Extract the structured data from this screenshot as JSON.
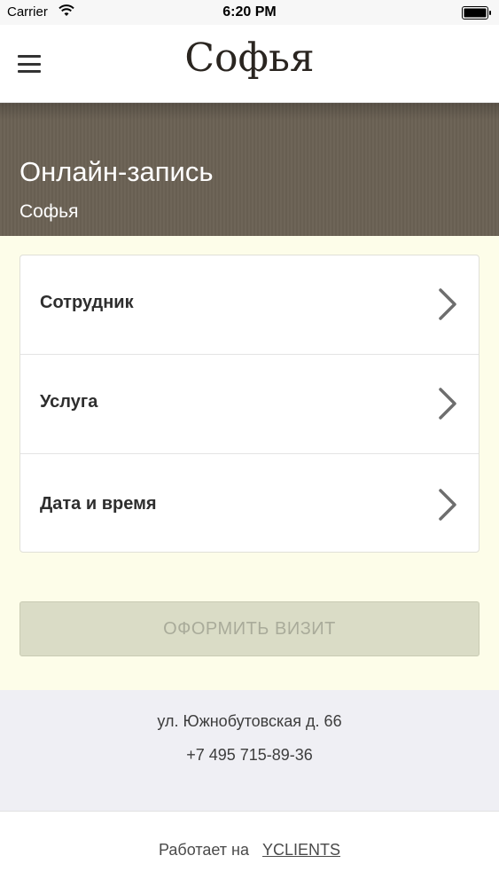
{
  "status_bar": {
    "carrier": "Carrier",
    "time": "6:20 PM"
  },
  "header": {
    "brand": "Софья",
    "menu_icon": "hamburger-menu-icon"
  },
  "hero": {
    "title": "Онлайн-запись",
    "subtitle": "Софья"
  },
  "booking": {
    "rows": [
      {
        "label": "Сотрудник",
        "icon": "chevron-right-icon"
      },
      {
        "label": "Услуга",
        "icon": "chevron-right-icon"
      },
      {
        "label": "Дата и время",
        "icon": "chevron-right-icon"
      }
    ],
    "submit_label": "ОФОРМИТЬ ВИЗИТ",
    "submit_enabled": false
  },
  "footer": {
    "address": "ул. Южнобутовская д. 66",
    "phone": "+7 495 715-89-36",
    "powered_by_text": "Работает на",
    "powered_by_link": "YCLIENTS"
  },
  "colors": {
    "hero_bg": "#6b6255",
    "main_bg": "#fdfde9",
    "button_disabled_bg": "#dadcc6",
    "footer_bg": "#efeff4"
  }
}
